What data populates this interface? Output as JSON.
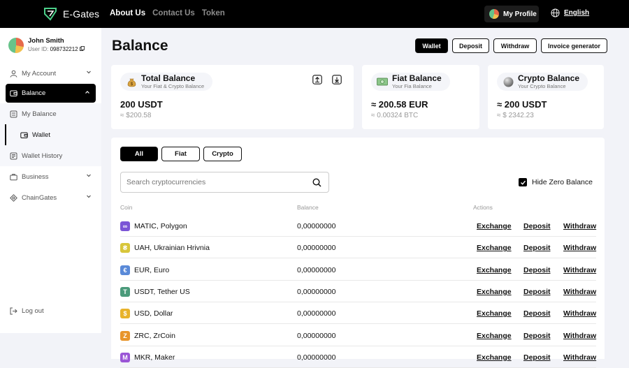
{
  "topbar": {
    "logo_text": "E-Gates",
    "nav": [
      "About Us",
      "Contact Us",
      "Token"
    ],
    "profile_label": "My Profile",
    "language": "English"
  },
  "user": {
    "name": "John Smith",
    "id_label": "User ID:",
    "id_value": "098732212"
  },
  "sidebar": {
    "my_account": "My Account",
    "balance": "Balance",
    "sub": [
      "My Balance",
      "Wallet",
      "Wallet History"
    ],
    "business": "Business",
    "chaingates": "ChainGates",
    "logout": "Log out"
  },
  "page": {
    "title": "Balance",
    "buttons": [
      "Wallet",
      "Deposit",
      "Withdraw",
      "Invoice generator"
    ]
  },
  "cards": [
    {
      "title": "Total Balance",
      "subtitle": "Your Fiat & Crypto Balance",
      "value": "200 USDT",
      "sub_value": "≈ $200.58"
    },
    {
      "title": "Fiat Balance",
      "subtitle": "Your Fia Balance",
      "value": "≈ 200.58 EUR",
      "sub_value": "≈ 0.00324 BTC"
    },
    {
      "title": "Crypto Balance",
      "subtitle": "Your Crypto Balance",
      "value": "≈ 200 USDT",
      "sub_value": "≈ $ 2342.23"
    }
  ],
  "filters": [
    "All",
    "Fiat",
    "Crypto"
  ],
  "search": {
    "placeholder": "Search cryptocurrencies"
  },
  "hide_zero_label": "Hide Zero Balance",
  "table": {
    "headers": [
      "Coin",
      "Balance",
      "Actions"
    ],
    "actions": [
      "Exchange",
      "Deposit",
      "Withdraw"
    ],
    "rows": [
      {
        "coin": "MATIC, Polygon",
        "balance": "0,00000000",
        "icon": "∞",
        "color": "#7b55d6"
      },
      {
        "coin": "UAH, Ukrainian Hrivnia",
        "balance": "0,00000000",
        "icon": "₴",
        "color": "#d8c63a"
      },
      {
        "coin": "EUR, Euro",
        "balance": "0,00000000",
        "icon": "€",
        "color": "#5a8ad8"
      },
      {
        "coin": "USDT, Tether US",
        "balance": "0,00000000",
        "icon": "T",
        "color": "#4a9a7a"
      },
      {
        "coin": "USD, Dollar",
        "balance": "0,00000000",
        "icon": "$",
        "color": "#e8b32b"
      },
      {
        "coin": "ZRC, ZrCoin",
        "balance": "0,00000000",
        "icon": "Z",
        "color": "#e8952b"
      },
      {
        "coin": "MKR, Maker",
        "balance": "0,00000000",
        "icon": "M",
        "color": "#9a55d6"
      }
    ]
  }
}
